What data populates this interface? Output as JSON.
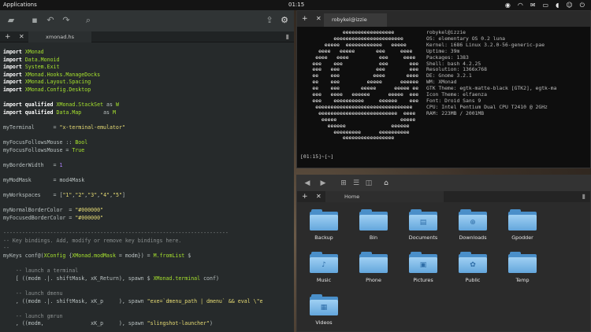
{
  "panel": {
    "applications": "Applications",
    "clock": "01:15",
    "icons": [
      "record-icon",
      "wifi-icon",
      "mail-icon",
      "battery-icon",
      "volume-icon",
      "user-icon",
      "power-icon"
    ]
  },
  "editor": {
    "tab_title": "xmonad.hs",
    "code": [
      [
        [
          "kw",
          "import"
        ],
        [
          "t",
          " "
        ],
        [
          "mod",
          "XMonad"
        ]
      ],
      [
        [
          "kw",
          "import"
        ],
        [
          "t",
          " "
        ],
        [
          "mod",
          "Data.Monoid"
        ]
      ],
      [
        [
          "kw",
          "import"
        ],
        [
          "t",
          " "
        ],
        [
          "mod",
          "System.Exit"
        ]
      ],
      [
        [
          "kw",
          "import"
        ],
        [
          "t",
          " "
        ],
        [
          "mod",
          "XMonad.Hooks.ManageDocks"
        ]
      ],
      [
        [
          "kw",
          "import"
        ],
        [
          "t",
          " "
        ],
        [
          "mod",
          "XMonad.Layout.Spacing"
        ]
      ],
      [
        [
          "kw",
          "import"
        ],
        [
          "t",
          " "
        ],
        [
          "mod",
          "XMonad.Config.Desktop"
        ]
      ],
      [
        [
          "t",
          ""
        ]
      ],
      [
        [
          "kw",
          "import qualified"
        ],
        [
          "t",
          " "
        ],
        [
          "mod",
          "XMonad.StackSet"
        ],
        [
          "t",
          " as "
        ],
        [
          "mod",
          "W"
        ]
      ],
      [
        [
          "kw",
          "import qualified"
        ],
        [
          "t",
          " "
        ],
        [
          "mod",
          "Data.Map"
        ],
        [
          "t",
          "       as "
        ],
        [
          "mod",
          "M"
        ]
      ],
      [
        [
          "t",
          ""
        ]
      ],
      [
        [
          "t",
          "myTerminal      = "
        ],
        [
          "str",
          "\"x-terminal-emulator\""
        ]
      ],
      [
        [
          "t",
          ""
        ]
      ],
      [
        [
          "t",
          "myFocusFollowsMouse :: "
        ],
        [
          "mod",
          "Bool"
        ]
      ],
      [
        [
          "t",
          "myFocusFollowsMouse = "
        ],
        [
          "mod",
          "True"
        ]
      ],
      [
        [
          "t",
          ""
        ]
      ],
      [
        [
          "t",
          "myBorderWidth   = "
        ],
        [
          "num",
          "1"
        ]
      ],
      [
        [
          "t",
          ""
        ]
      ],
      [
        [
          "t",
          "myModMask       = mod4Mask"
        ]
      ],
      [
        [
          "t",
          ""
        ]
      ],
      [
        [
          "t",
          "myWorkspaces    = ["
        ],
        [
          "str",
          "\"1\""
        ],
        [
          "t",
          ","
        ],
        [
          "str",
          "\"2\""
        ],
        [
          "t",
          ","
        ],
        [
          "str",
          "\"3\""
        ],
        [
          "t",
          ","
        ],
        [
          "str",
          "\"4\""
        ],
        [
          "t",
          ","
        ],
        [
          "str",
          "\"5\""
        ],
        [
          "t",
          "]"
        ]
      ],
      [
        [
          "t",
          ""
        ]
      ],
      [
        [
          "t",
          "myNormalBorderColor  = "
        ],
        [
          "str",
          "\"#000000\""
        ]
      ],
      [
        [
          "t",
          "myFocusedBorderColor = "
        ],
        [
          "str",
          "\"#000000\""
        ]
      ],
      [
        [
          "t",
          ""
        ]
      ],
      [
        [
          "cm",
          "------------------------------------------------------------------------"
        ]
      ],
      [
        [
          "cm",
          "-- Key bindings. Add, modify or remove key bindings here."
        ]
      ],
      [
        [
          "cm",
          "--"
        ]
      ],
      [
        [
          "t",
          "myKeys conf@("
        ],
        [
          "fn",
          "XConfig"
        ],
        [
          "t",
          " {"
        ],
        [
          "fn",
          "XMonad.modMask"
        ],
        [
          "t",
          " = modm}) = "
        ],
        [
          "fn",
          "M.fromList"
        ],
        [
          "t",
          " $"
        ]
      ],
      [
        [
          "t",
          ""
        ]
      ],
      [
        [
          "cm",
          "    -- launch a terminal"
        ]
      ],
      [
        [
          "t",
          "    [ ((modm .|. shiftMask, xK_Return), spawn $ "
        ],
        [
          "fn",
          "XMonad.terminal"
        ],
        [
          "t",
          " conf)"
        ]
      ],
      [
        [
          "t",
          ""
        ]
      ],
      [
        [
          "cm",
          "    -- launch dmenu"
        ]
      ],
      [
        [
          "t",
          "    , ((modm .|. shiftMask, xK_p     ), spawn "
        ],
        [
          "str",
          "\"exe=`dmenu_path | dmenu` && eval \\\"e"
        ]
      ],
      [
        [
          "t",
          ""
        ]
      ],
      [
        [
          "cm",
          "    -- launch gmrun"
        ]
      ],
      [
        [
          "t",
          "    , ((modm,               xK_p     ), spawn "
        ],
        [
          "str",
          "\"slingshot-launcher\""
        ],
        [
          "t",
          ")"
        ]
      ]
    ]
  },
  "terminal": {
    "tab_title": "robykel@izzie",
    "logo": [
      "              eeeeeeeeeeeeeeeee",
      "           eeeeeeeeeeeeeeeeeeeeeee",
      "        eeeee  eeeeeeeeeeee   eeeee",
      "      eeee   eeeee       eee     eeee",
      "     eeee   eeee          eee     eeee",
      "    eee    eee            eee       eee",
      "    eee   eee            eee        eee",
      "    ee    eee           eeee       eeee",
      "    ee    eee         eeeee      eeeeee",
      "    ee    eee       eeeee      eeeee ee",
      "    eee   eeee   eeeeee      eeeee  eee",
      "    eee    eeeeeeeeee     eeeeee    eee",
      "     eeeeeeeeeeeeeeeeeeeeeeeeeeeeeeee",
      "      eeeeeeeeeeeeeeeeeeeeeeeeee  eeee",
      "       eeeee                     eeeee",
      "         eeeeee               eeeeee",
      "           eeeeeeeee      eeeeeeeeee",
      "              eeeeeeeeeeeeeeeee"
    ],
    "info": [
      "robykel@izzie",
      "OS: elementary OS 0.2 luna",
      "Kernel: i686 Linux 3.2.0-56-generic-pae",
      "Uptime: 39m",
      "Packages: 1383",
      "Shell: bash 4.2.25",
      "Resolution: 1366x768",
      "DE: Gnome 3.2.1",
      "WM: XMonad",
      "GTK Theme: egtk-matte-black [GTK2], egtk-ma",
      "Icon Theme: elfaenza",
      "Font: Droid Sans 9",
      "CPU: Intel Pentium Dual CPU T2410 @ 2GHz",
      "RAM: 223MB / 2001MB"
    ],
    "prompt_line1": "[01:15]~[~]",
    "prompt_line2": "[]"
  },
  "files": {
    "tab_title": "Home",
    "folders": [
      {
        "label": "Backup",
        "emblem": ""
      },
      {
        "label": "Bin",
        "emblem": ""
      },
      {
        "label": "Documents",
        "emblem": "▤"
      },
      {
        "label": "Downloads",
        "emblem": "⊕"
      },
      {
        "label": "Gpodder",
        "emblem": ""
      },
      {
        "label": "Music",
        "emblem": "♪"
      },
      {
        "label": "Phone",
        "emblem": ""
      },
      {
        "label": "Pictures",
        "emblem": "▣"
      },
      {
        "label": "Public",
        "emblem": "✿"
      },
      {
        "label": "Temp",
        "emblem": ""
      },
      {
        "label": "Videos",
        "emblem": "▦"
      }
    ]
  }
}
